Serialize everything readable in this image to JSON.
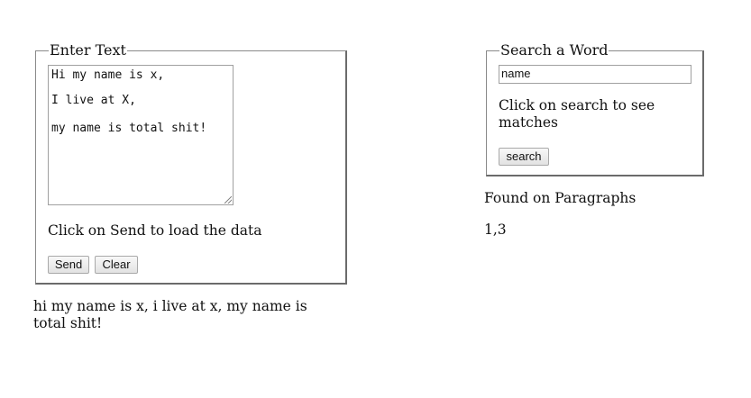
{
  "enter_text": {
    "legend": "Enter Text",
    "textarea_lines": [
      "Hi my name is x,",
      "I live at X,",
      "my name is total shit!"
    ],
    "instruction": "Click on Send to load the data",
    "send_label": "Send",
    "clear_label": "Clear"
  },
  "output_text": "hi my name is x, i live at x, my name is total shit!",
  "search": {
    "legend": "Search a Word",
    "input_value": "name",
    "instruction": "Click on search to see matches",
    "search_label": "search"
  },
  "results": {
    "heading": "Found on Paragraphs",
    "value": "1,3"
  }
}
